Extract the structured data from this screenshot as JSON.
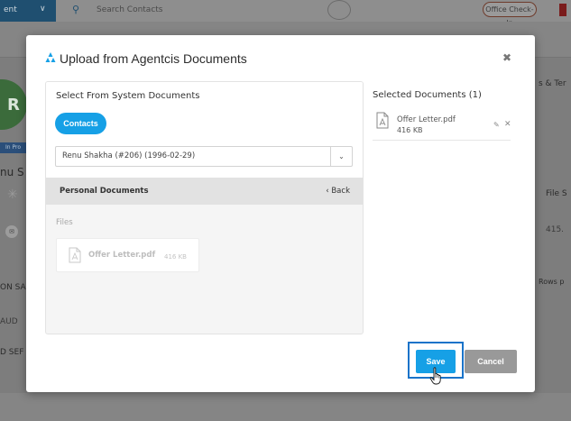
{
  "background": {
    "topbar_left_label": "ent",
    "search_placeholder": "Search Contacts",
    "checkin_label": "Office Check-In",
    "avatar_initial": "R",
    "status_badge": "In Pro",
    "name_fragment": "nu S",
    "section_on": "ON SA",
    "section_aud": "AUD",
    "section_dse": "D SEF",
    "right_ter": "s & Ter",
    "right_files": "File S",
    "right_415": "415.",
    "right_rows": "Rows p"
  },
  "modal": {
    "title": "Upload from Agentcis Documents",
    "close_icon": "close-icon",
    "left": {
      "heading": "Select From System Documents",
      "contacts_button": "Contacts",
      "contact_selected": "Renu Shakha (#206) (1996-02-29)",
      "personal_documents": "Personal Documents",
      "back_label": "‹ Back",
      "files_label": "Files",
      "file": {
        "name": "Offer Letter.pdf",
        "size": "416 KB"
      }
    },
    "right": {
      "heading": "Selected Documents (1)",
      "items": [
        {
          "name": "Offer Letter.pdf",
          "size": "416 KB"
        }
      ]
    },
    "footer": {
      "save_label": "Save",
      "cancel_label": "Cancel"
    }
  },
  "colors": {
    "accent": "#16a0e6",
    "focus_outline": "#1a73c9",
    "cancel": "#999999"
  }
}
